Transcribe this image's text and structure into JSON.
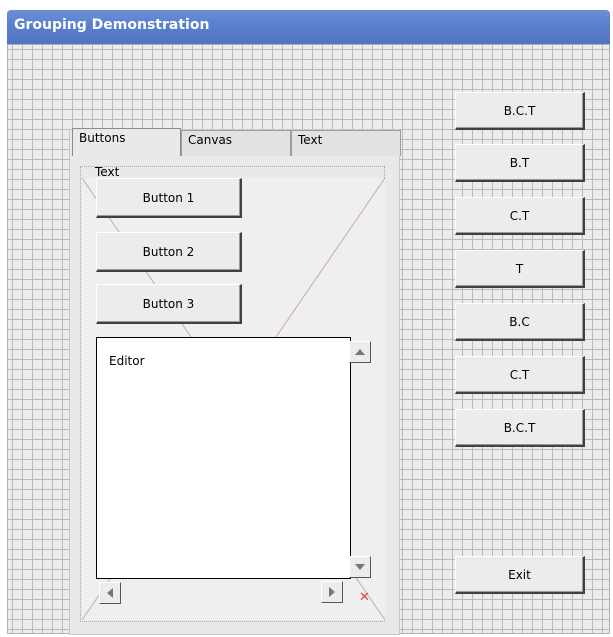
{
  "window": {
    "title": "Grouping Demonstration"
  },
  "tabs": [
    {
      "label": "Buttons",
      "active": true
    },
    {
      "label": "Canvas",
      "active": false
    },
    {
      "label": "Text",
      "active": false
    }
  ],
  "page": {
    "group_label": "Text",
    "buttons": [
      "Button 1",
      "Button 2",
      "Button 3"
    ],
    "editor_text": "Editor"
  },
  "right_buttons": [
    "B.C.T",
    "B.T",
    "C.T",
    "T",
    "B.C",
    "C.T",
    "B.C.T"
  ],
  "exit_label": "Exit",
  "colors": {
    "titlebar": "#5a7fcc",
    "grid": "#b9b9b9",
    "close_x": "#e84040"
  },
  "icons": {
    "scroll_up": "triangle-up",
    "scroll_down": "triangle-down",
    "scroll_left": "triangle-left",
    "scroll_right": "triangle-right",
    "close": "x-mark"
  }
}
